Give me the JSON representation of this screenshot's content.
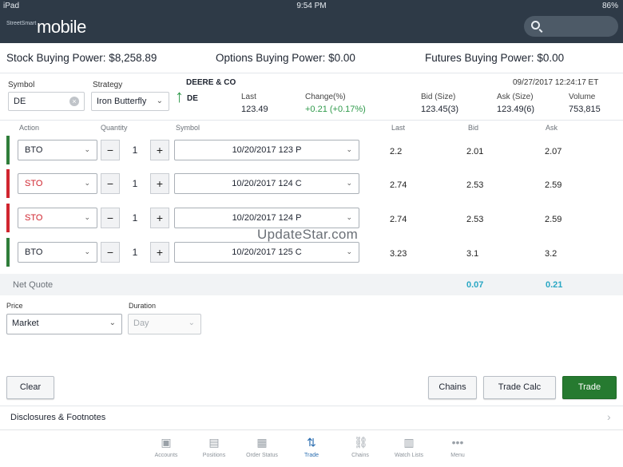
{
  "status_bar": {
    "left": "iPad",
    "time": "9:54 PM",
    "battery": "86%"
  },
  "app": {
    "brand_small": "StreetSmart",
    "brand_big": "mobile"
  },
  "buying_power": {
    "stock": "Stock Buying Power: $8,258.89",
    "options": "Options Buying Power: $0.00",
    "futures": "Futures Buying Power: $0.00"
  },
  "symbol": {
    "label": "Symbol",
    "value": "DE"
  },
  "strategy": {
    "label": "Strategy",
    "value": "Iron Butterfly"
  },
  "quote": {
    "company": "DEERE & CO",
    "ticker": "DE",
    "timestamp": "09/27/2017 12:24:17 ET",
    "last_label": "Last",
    "last": "123.49",
    "change_label": "Change(%)",
    "change": "+0.21 (+0.17%)",
    "bid_label": "Bid (Size)",
    "bid": "123.45(3)",
    "ask_label": "Ask (Size)",
    "ask": "123.49(6)",
    "volume_label": "Volume",
    "volume": "753,815"
  },
  "legs_header": {
    "action": "Action",
    "quantity": "Quantity",
    "symbol": "Symbol",
    "last": "Last",
    "bid": "Bid",
    "ask": "Ask"
  },
  "legs": [
    {
      "action": "BTO",
      "qty": "1",
      "symbol": "10/20/2017 123 P",
      "last": "2.2",
      "bid": "2.01",
      "ask": "2.07"
    },
    {
      "action": "STO",
      "qty": "1",
      "symbol": "10/20/2017 124 C",
      "last": "2.74",
      "bid": "2.53",
      "ask": "2.59"
    },
    {
      "action": "STO",
      "qty": "1",
      "symbol": "10/20/2017 124 P",
      "last": "2.74",
      "bid": "2.53",
      "ask": "2.59"
    },
    {
      "action": "BTO",
      "qty": "1",
      "symbol": "10/20/2017 125 C",
      "last": "3.23",
      "bid": "3.1",
      "ask": "3.2"
    }
  ],
  "net_quote": {
    "label": "Net Quote",
    "bid": "0.07",
    "ask": "0.21"
  },
  "stepper": {
    "minus": "−",
    "plus": "+"
  },
  "price": {
    "label": "Price",
    "value": "Market"
  },
  "duration": {
    "label": "Duration",
    "value": "Day"
  },
  "buttons": {
    "clear": "Clear",
    "chains": "Chains",
    "trade_calc": "Trade Calc",
    "trade": "Trade"
  },
  "disclosures": "Disclosures & Footnotes",
  "watermark": "UpdateStar.com",
  "tabs": [
    {
      "label": "Accounts",
      "icon": "accounts-icon"
    },
    {
      "label": "Positions",
      "icon": "positions-icon"
    },
    {
      "label": "Order Status",
      "icon": "order-status-icon"
    },
    {
      "label": "Trade",
      "icon": "trade-icon"
    },
    {
      "label": "Chains",
      "icon": "chains-icon"
    },
    {
      "label": "Watch Lists",
      "icon": "watch-lists-icon"
    },
    {
      "label": "Menu",
      "icon": "menu-icon"
    }
  ],
  "colors": {
    "buy_leg": "#2f7d3a",
    "sell_leg": "#d0252f",
    "appbar": "#2e3a47",
    "trade_button": "#267a30",
    "net_quote": "#2aa7c4"
  }
}
